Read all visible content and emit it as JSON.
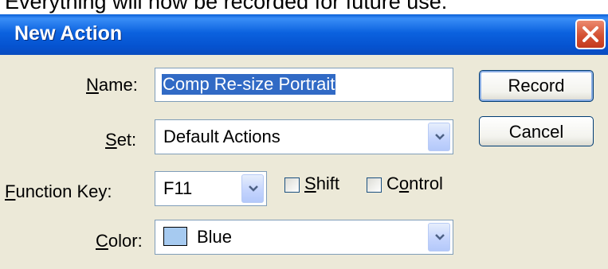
{
  "caption": "Everything will now be recorded for future use.",
  "window": {
    "title": "New Action"
  },
  "form": {
    "name": {
      "label_mnemonic": "N",
      "label_rest": "ame:",
      "value": "Comp Re-size Portrait"
    },
    "set": {
      "label_mnemonic": "S",
      "label_rest": "et:",
      "selected": "Default Actions"
    },
    "function_key": {
      "label_mnemonic": "F",
      "label_rest": "unction Key:",
      "selected": "F11",
      "shift": {
        "label_mnemonic": "S",
        "label_rest": "hift",
        "checked": false
      },
      "control": {
        "label_pre": "C",
        "label_mnemonic": "o",
        "label_rest": "ntrol",
        "checked": false
      }
    },
    "color": {
      "label_mnemonic": "C",
      "label_rest": "olor:",
      "selected": "Blue",
      "swatch_color": "#a6caf0"
    }
  },
  "buttons": {
    "record": "Record",
    "cancel": "Cancel"
  },
  "colors": {
    "titlebar": "#0b62df",
    "dialog_bg": "#ece9d8",
    "selection": "#316ac5",
    "close": "#d45133"
  }
}
